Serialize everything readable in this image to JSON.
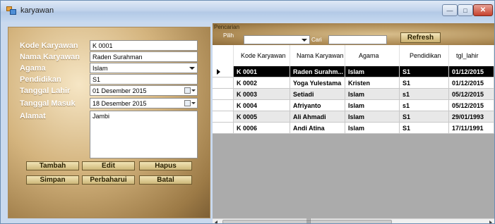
{
  "window": {
    "title": "karyawan"
  },
  "form": {
    "kode_label": "Kode Karyawan",
    "kode_value": "K 0001",
    "nama_label": "Nama Karyawan",
    "nama_value": "Raden Surahman",
    "agama_label": "Agama",
    "agama_value": "Islam",
    "pendidikan_label": "Pendidikan",
    "pendidikan_value": "S1",
    "tgl_lahir_label": "Tanggal Lahir",
    "tgl_lahir_value": "01 Desember 2015",
    "tgl_masuk_label": "Tanggal Masuk",
    "tgl_masuk_value": "18 Desember 2015",
    "alamat_label": "Alamat",
    "alamat_value": "Jambi"
  },
  "buttons": {
    "tambah": "Tambah",
    "edit": "Edit",
    "hapus": "Hapus",
    "simpan": "Simpan",
    "perbaharui": "Perbaharui",
    "batal": "Batal"
  },
  "search": {
    "group_caption": "Pencarian",
    "pilih_label": "Pilih",
    "cari_label": "Cari",
    "pilih_value": "",
    "cari_value": "",
    "refresh_label": "Refresh"
  },
  "grid": {
    "headers": {
      "kode": "Kode Karyawan",
      "nama": "Nama Karyawan",
      "agama": "Agama",
      "pendidikan": "Pendidikan",
      "tgl_lahir": "tgl_lahir"
    },
    "rows": [
      {
        "kode": "K 0001",
        "nama": "Raden Surahm...",
        "agama": "Islam",
        "pendidikan": "S1",
        "tgl_lahir": "01/12/2015"
      },
      {
        "kode": "K 0002",
        "nama": "Yoga Yulestama",
        "agama": "Kristen",
        "pendidikan": "S1",
        "tgl_lahir": "01/12/2015"
      },
      {
        "kode": "K 0003",
        "nama": "Setiadi",
        "agama": "Islam",
        "pendidikan": "s1",
        "tgl_lahir": "05/12/2015"
      },
      {
        "kode": "K 0004",
        "nama": "Afriyanto",
        "agama": "Islam",
        "pendidikan": "s1",
        "tgl_lahir": "05/12/2015"
      },
      {
        "kode": "K 0005",
        "nama": "Ali Ahmadi",
        "agama": "Islam",
        "pendidikan": "S1",
        "tgl_lahir": "29/01/1993"
      },
      {
        "kode": "K 0006",
        "nama": "Andi Atina",
        "agama": "Islam",
        "pendidikan": "S1",
        "tgl_lahir": "17/11/1991"
      }
    ]
  },
  "icons": {
    "app": "app-icon",
    "minimize": "minimize-icon",
    "maximize": "maximize-icon",
    "close": "close-icon"
  },
  "colors": {
    "selected_row_bg": "#000000",
    "grid_background": "#ababab",
    "close_button": "#c6402c"
  }
}
